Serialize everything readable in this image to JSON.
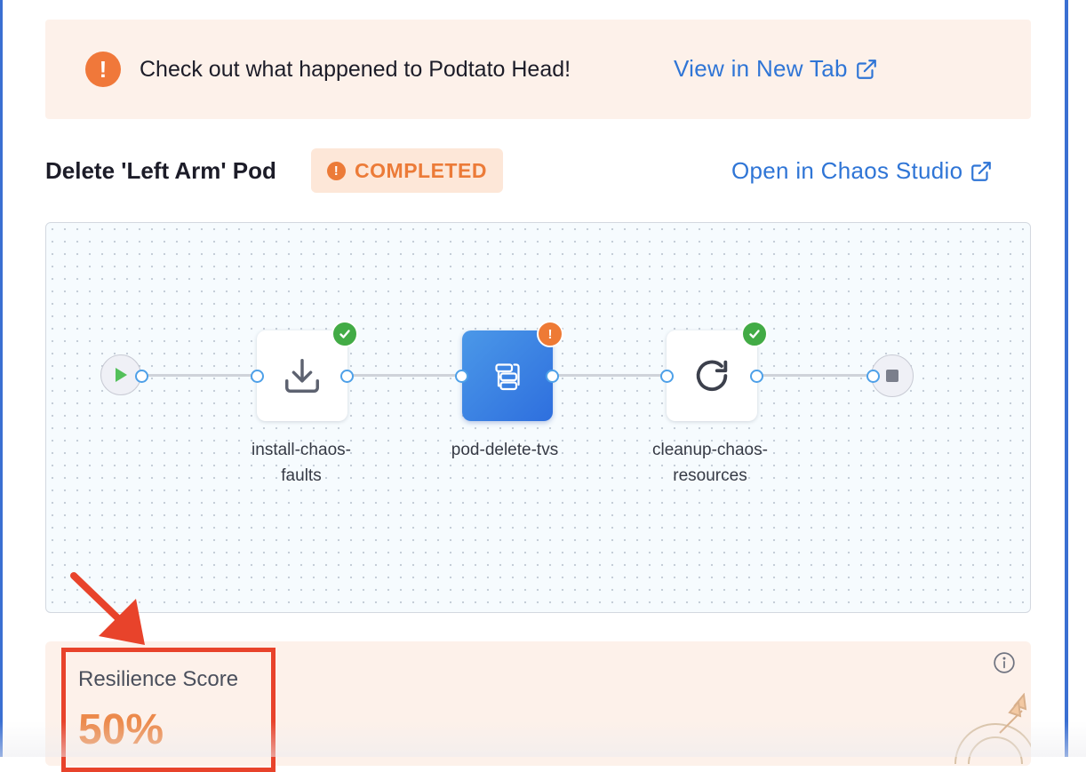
{
  "banner": {
    "icon": "warning-circle-icon",
    "message": "Check out what happened to Podtato Head!",
    "link_label": "View in New Tab",
    "link_icon": "external-link-icon"
  },
  "experiment": {
    "title": "Delete 'Left Arm' Pod",
    "status": "COMPLETED",
    "status_color": "#ec7b38",
    "open_studio_label": "Open in Chaos Studio"
  },
  "pipeline": {
    "steps": [
      {
        "label_line1": "install-chaos-",
        "label_line2": "faults",
        "icon": "download-icon",
        "status": "success"
      },
      {
        "label_line1": "pod-delete-tvs",
        "label_line2": "",
        "icon": "chaos-fault-icon",
        "status": "warning"
      },
      {
        "label_line1": "cleanup-chaos-",
        "label_line2": "resources",
        "icon": "refresh-icon",
        "status": "success"
      }
    ]
  },
  "resilience": {
    "label": "Resilience Score",
    "value": "50%",
    "score_percent": 50
  },
  "colors": {
    "accent_blue": "#2f75d6",
    "warning_orange": "#ec7b38",
    "success_green": "#42ab45",
    "annotation_red": "#e8432b"
  }
}
